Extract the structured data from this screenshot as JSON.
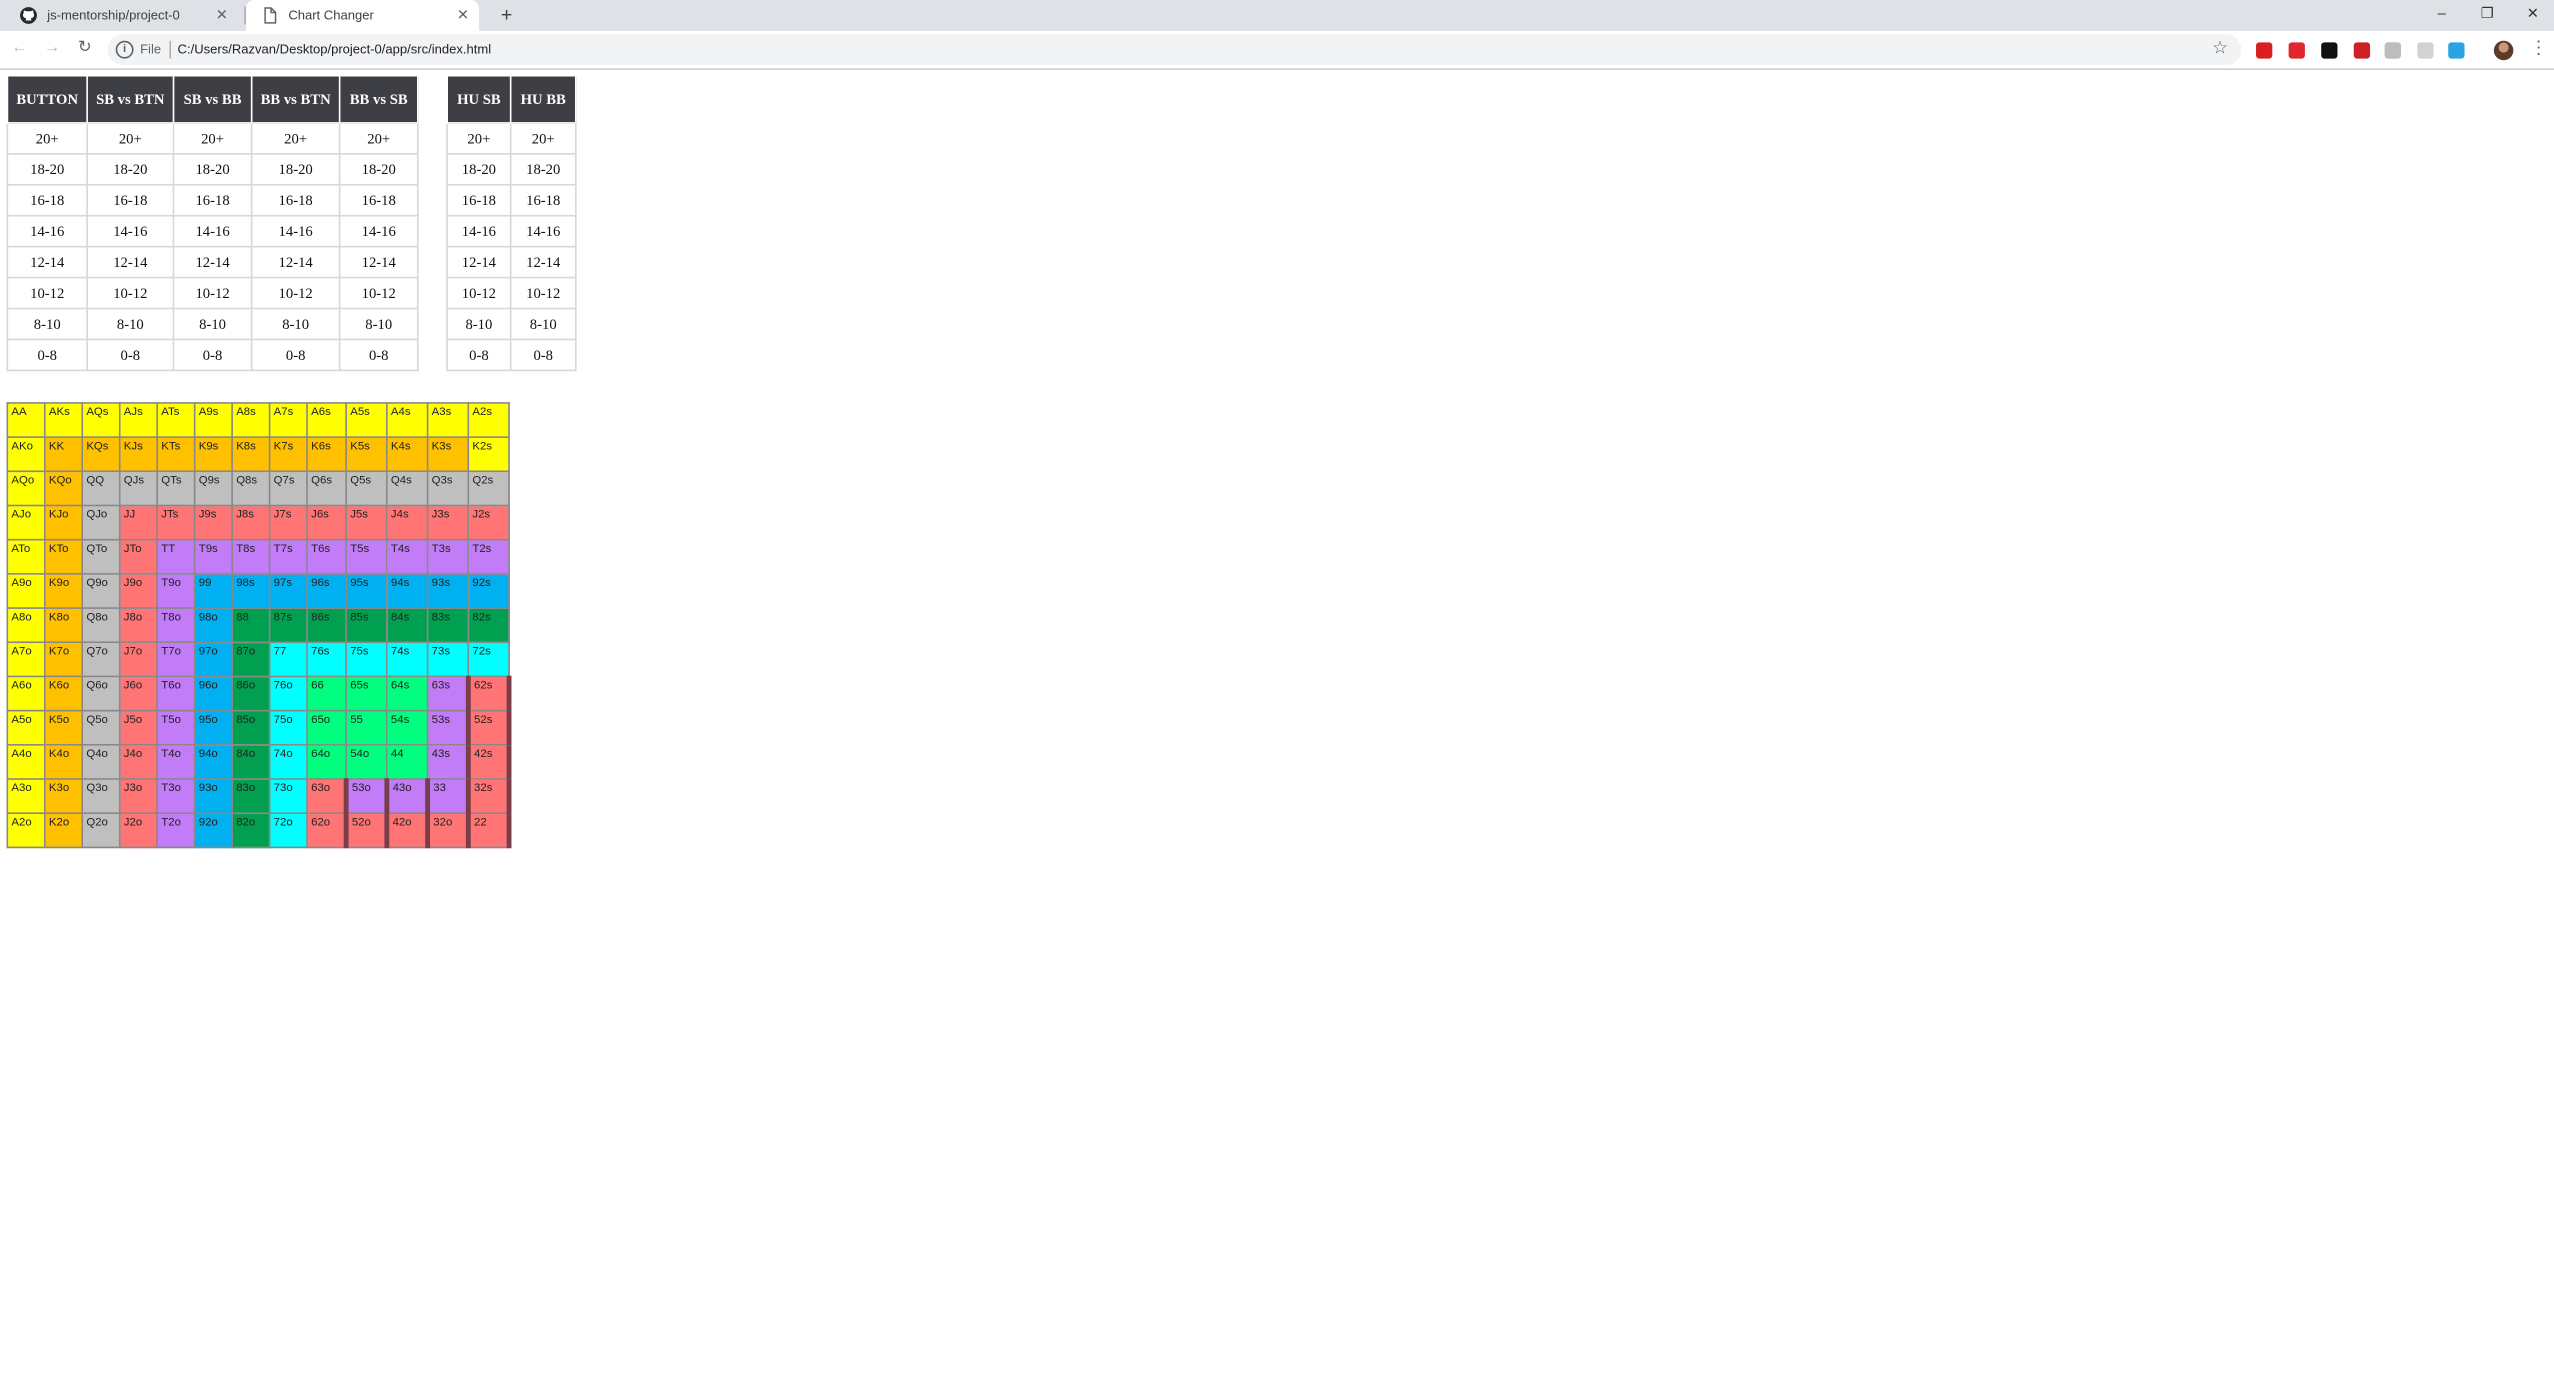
{
  "browser": {
    "tabs": [
      {
        "title": "js-mentorship/project-0",
        "icon": "github-icon",
        "active": false
      },
      {
        "title": "Chart Changer",
        "icon": "page-icon",
        "active": true
      }
    ],
    "new_tab": "+",
    "window_controls": {
      "minimize": "–",
      "restore": "❐",
      "close": "✕"
    },
    "nav": {
      "back": "←",
      "forward": "→",
      "reload": "↻"
    },
    "scheme_label": "File",
    "url": "C:/Users/Razvan/Desktop/project-0/app/src/index.html",
    "extensions": [
      {
        "name": "adblock-icon",
        "color": "#d81e1e"
      },
      {
        "name": "shield-extension-icon",
        "color": "#e0262f"
      },
      {
        "name": "camera-extension-icon",
        "color": "#111111"
      },
      {
        "name": "lastpass-icon",
        "color": "#cc1f26"
      },
      {
        "name": "cloud-extension-icon",
        "color": "#c9c9c9"
      },
      {
        "name": "doc-extension-icon",
        "color": "#bdbdbd"
      },
      {
        "name": "file-extension-icon",
        "color": "#d2d2d2"
      },
      {
        "name": "screen-capture-icon",
        "color": "#2aa3e0"
      }
    ]
  },
  "position_table": {
    "headers": [
      "BUTTON",
      "SB vs BTN",
      "SB vs BB",
      "BB vs BTN",
      "BB vs SB"
    ],
    "rows": [
      "20+",
      "18-20",
      "16-18",
      "14-16",
      "12-14",
      "10-12",
      "8-10",
      "0-8"
    ]
  },
  "hu_table": {
    "headers": [
      "HU SB",
      "HU BB"
    ],
    "rows": [
      "20+",
      "18-20",
      "16-18",
      "14-16",
      "12-14",
      "10-12",
      "8-10",
      "0-8"
    ]
  },
  "hand_chart": {
    "palette": {
      "Y": "#ffff00",
      "O": "#ffc000",
      "G": "#bfbfbf",
      "R": "#ff7575",
      "P": "#c27cf7",
      "B": "#00b0f0",
      "D": "#00a050",
      "C": "#00ffff",
      "L": "#00ff7f"
    },
    "rows": [
      [
        "AA",
        "AKs",
        "AQs",
        "AJs",
        "ATs",
        "A9s",
        "A8s",
        "A7s",
        "A6s",
        "A5s",
        "A4s",
        "A3s",
        "A2s"
      ],
      [
        "AKo",
        "KK",
        "KQs",
        "KJs",
        "KTs",
        "K9s",
        "K8s",
        "K7s",
        "K6s",
        "K5s",
        "K4s",
        "K3s",
        "K2s"
      ],
      [
        "AQo",
        "KQo",
        "QQ",
        "QJs",
        "QTs",
        "Q9s",
        "Q8s",
        "Q7s",
        "Q6s",
        "Q5s",
        "Q4s",
        "Q3s",
        "Q2s"
      ],
      [
        "AJo",
        "KJo",
        "QJo",
        "JJ",
        "JTs",
        "J9s",
        "J8s",
        "J7s",
        "J6s",
        "J5s",
        "J4s",
        "J3s",
        "J2s"
      ],
      [
        "ATo",
        "KTo",
        "QTo",
        "JTo",
        "TT",
        "T9s",
        "T8s",
        "T7s",
        "T6s",
        "T5s",
        "T4s",
        "T3s",
        "T2s"
      ],
      [
        "A9o",
        "K9o",
        "Q9o",
        "J9o",
        "T9o",
        "99",
        "98s",
        "97s",
        "96s",
        "95s",
        "94s",
        "93s",
        "92s"
      ],
      [
        "A8o",
        "K8o",
        "Q8o",
        "J8o",
        "T8o",
        "98o",
        "88",
        "87s",
        "86s",
        "85s",
        "84s",
        "83s",
        "82s"
      ],
      [
        "A7o",
        "K7o",
        "Q7o",
        "J7o",
        "T7o",
        "97o",
        "87o",
        "77",
        "76s",
        "75s",
        "74s",
        "73s",
        "72s"
      ],
      [
        "A6o",
        "K6o",
        "Q6o",
        "J6o",
        "T6o",
        "96o",
        "86o",
        "76o",
        "66",
        "65s",
        "64s",
        "63s",
        "62s"
      ],
      [
        "A5o",
        "K5o",
        "Q5o",
        "J5o",
        "T5o",
        "95o",
        "85o",
        "75o",
        "65o",
        "55",
        "54s",
        "53s",
        "52s"
      ],
      [
        "A4o",
        "K4o",
        "Q4o",
        "J4o",
        "T4o",
        "94o",
        "84o",
        "74o",
        "64o",
        "54o",
        "44",
        "43s",
        "42s"
      ],
      [
        "A3o",
        "K3o",
        "Q3o",
        "J3o",
        "T3o",
        "93o",
        "83o",
        "73o",
        "63o",
        "53o",
        "43o",
        "33",
        "32s"
      ],
      [
        "A2o",
        "K2o",
        "Q2o",
        "J2o",
        "T2o",
        "92o",
        "82o",
        "72o",
        "62o",
        "52o",
        "42o",
        "32o",
        "22"
      ]
    ],
    "colors": [
      "YYYYYYYYYYYYY",
      "YOOOOOOOOOOOY",
      "YOGGGGGGGGGGG",
      "YOGRRRRRRRRRR",
      "YOGRPPPPPPPPP",
      "YOGRPBBBBBBBB",
      "YOGRPBDDDDDDD",
      "YOGRPBDCCCCCC",
      "YOGRPBDCLLLPR",
      "YOGRPBDCLLLPR",
      "YOGRPBDCLLLPR",
      "YOGRPBDCRPPPR",
      "YOGRPBDCRRRRR"
    ],
    "edge_marks": [
      [
        8,
        11
      ],
      [
        8,
        12
      ],
      [
        9,
        11
      ],
      [
        9,
        12
      ],
      [
        10,
        11
      ],
      [
        10,
        12
      ],
      [
        11,
        8
      ],
      [
        11,
        9
      ],
      [
        11,
        10
      ],
      [
        11,
        11
      ],
      [
        11,
        12
      ],
      [
        12,
        8
      ],
      [
        12,
        9
      ],
      [
        12,
        10
      ],
      [
        12,
        11
      ],
      [
        12,
        12
      ]
    ]
  }
}
